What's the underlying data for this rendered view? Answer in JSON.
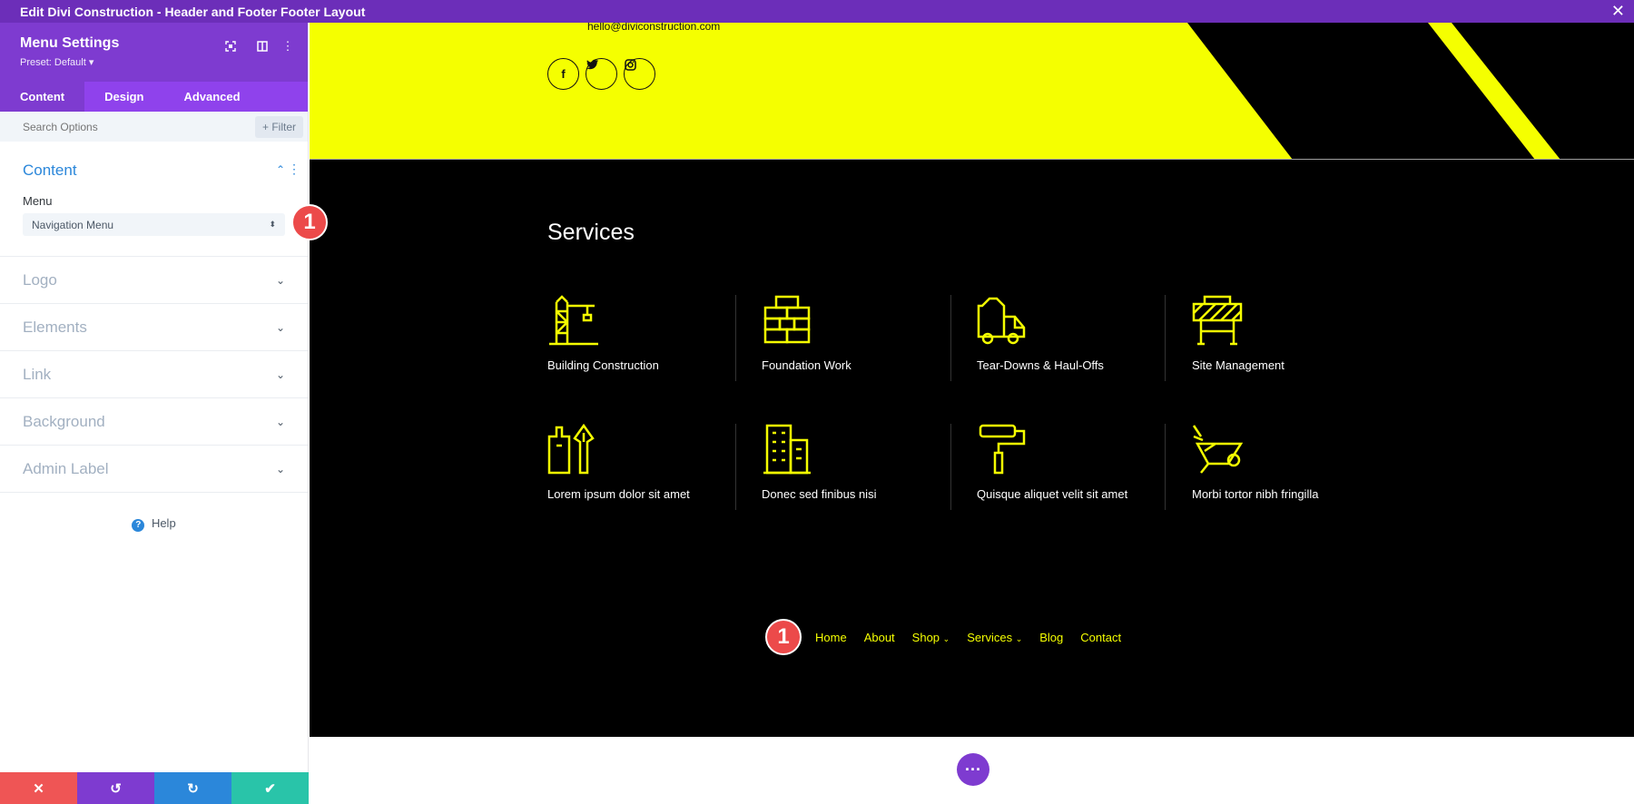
{
  "window": {
    "title": "Edit Divi Construction - Header and Footer Footer Layout",
    "close_glyph": "✕"
  },
  "panel": {
    "title": "Menu Settings",
    "preset": "Preset: Default ▾",
    "tabs": [
      "Content",
      "Design",
      "Advanced"
    ],
    "search_placeholder": "Search Options",
    "filter_label": "Filter",
    "open_section": {
      "title": "Content",
      "field_label": "Menu",
      "select_value": "Navigation Menu"
    },
    "sections": [
      "Logo",
      "Elements",
      "Link",
      "Background",
      "Admin Label"
    ],
    "help_label": "Help"
  },
  "bottom_bar": {
    "colors": [
      "#ef5555",
      "#7e3bd0",
      "#2b87da",
      "#29c4a9"
    ]
  },
  "badge": {
    "number": "1"
  },
  "canvas": {
    "email": "hello@diviconstruction.com",
    "social": [
      "facebook-icon",
      "twitter-icon",
      "instagram-icon"
    ],
    "services_title": "Services",
    "services": [
      {
        "label": "Building Construction",
        "icon": "crane-icon"
      },
      {
        "label": "Foundation Work",
        "icon": "brick-wall-icon"
      },
      {
        "label": "Tear-Downs & Haul-Offs",
        "icon": "truck-icon"
      },
      {
        "label": "Site Management",
        "icon": "barrier-icon"
      },
      {
        "label": "Lorem ipsum dolor sit amet",
        "icon": "paint-tools-icon"
      },
      {
        "label": "Donec sed finibus nisi",
        "icon": "building-icon"
      },
      {
        "label": "Quisque aliquet velit sit amet",
        "icon": "paint-roller-icon"
      },
      {
        "label": "Morbi tortor nibh fringilla",
        "icon": "wheelbarrow-icon"
      }
    ],
    "nav": [
      "Home",
      "About",
      "Shop",
      "Services",
      "Blog",
      "Contact"
    ]
  },
  "colors": {
    "accent_yellow": "#f5ff00",
    "divi_purple": "#7e3bd0",
    "badge_red": "#ec4a4a"
  }
}
